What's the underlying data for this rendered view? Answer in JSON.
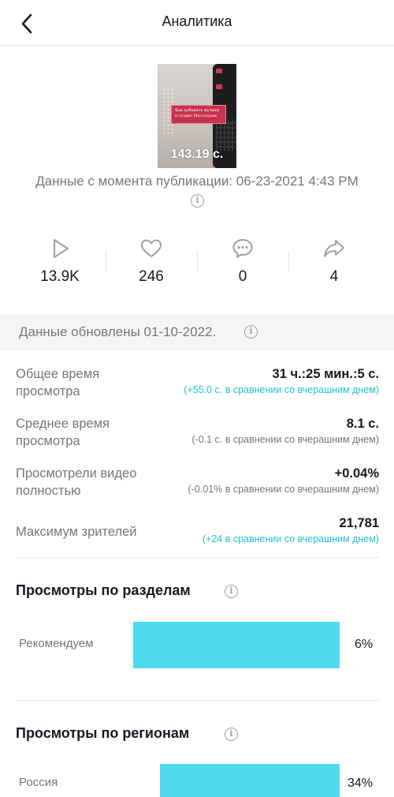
{
  "header": {
    "title": "Аналитика"
  },
  "video": {
    "thumbnail_text": "Как добавить музыку в сторис Инстаграм",
    "duration": "143.19 с.",
    "published": "Данные с момента публикации: 06-23-2021 4:43 PM"
  },
  "stats": {
    "views": "13.9K",
    "likes": "246",
    "comments": "0",
    "shares": "4"
  },
  "updated": {
    "text": "Данные обновлены 01-10-2022."
  },
  "metrics": [
    {
      "label": "Общее время просмотра",
      "value": "31 ч.:25 мин.:5 с.",
      "delta": "(+55.0 с. в сравнении со вчерашним днем)",
      "trend": "up"
    },
    {
      "label": "Среднее время просмотра",
      "value": "8.1 с.",
      "delta": "(-0.1 с. в сравнении со вчерашним днем)",
      "trend": "down"
    },
    {
      "label": "Просмотрели видео полностью",
      "value": "+0.04%",
      "delta": "(-0.01% в сравнении со вчерашним днем)",
      "trend": "down"
    },
    {
      "label": "Максимум зрителей",
      "value": "21,781",
      "delta": "(+24 в сравнении со вчерашним днем)",
      "trend": "up"
    }
  ],
  "sections": {
    "by_source": {
      "title": "Просмотры по разделам",
      "items": [
        {
          "label": "Рекомендуем",
          "percent": "6%",
          "fraction": 0.06
        }
      ]
    },
    "by_region": {
      "title": "Просмотры по регионам",
      "items": [
        {
          "label": "Россия",
          "percent": "34%",
          "fraction": 0.34
        }
      ]
    }
  },
  "colors": {
    "bar": "#4fdbee",
    "positive_delta": "#20c2d2",
    "muted_text": "#757679"
  }
}
